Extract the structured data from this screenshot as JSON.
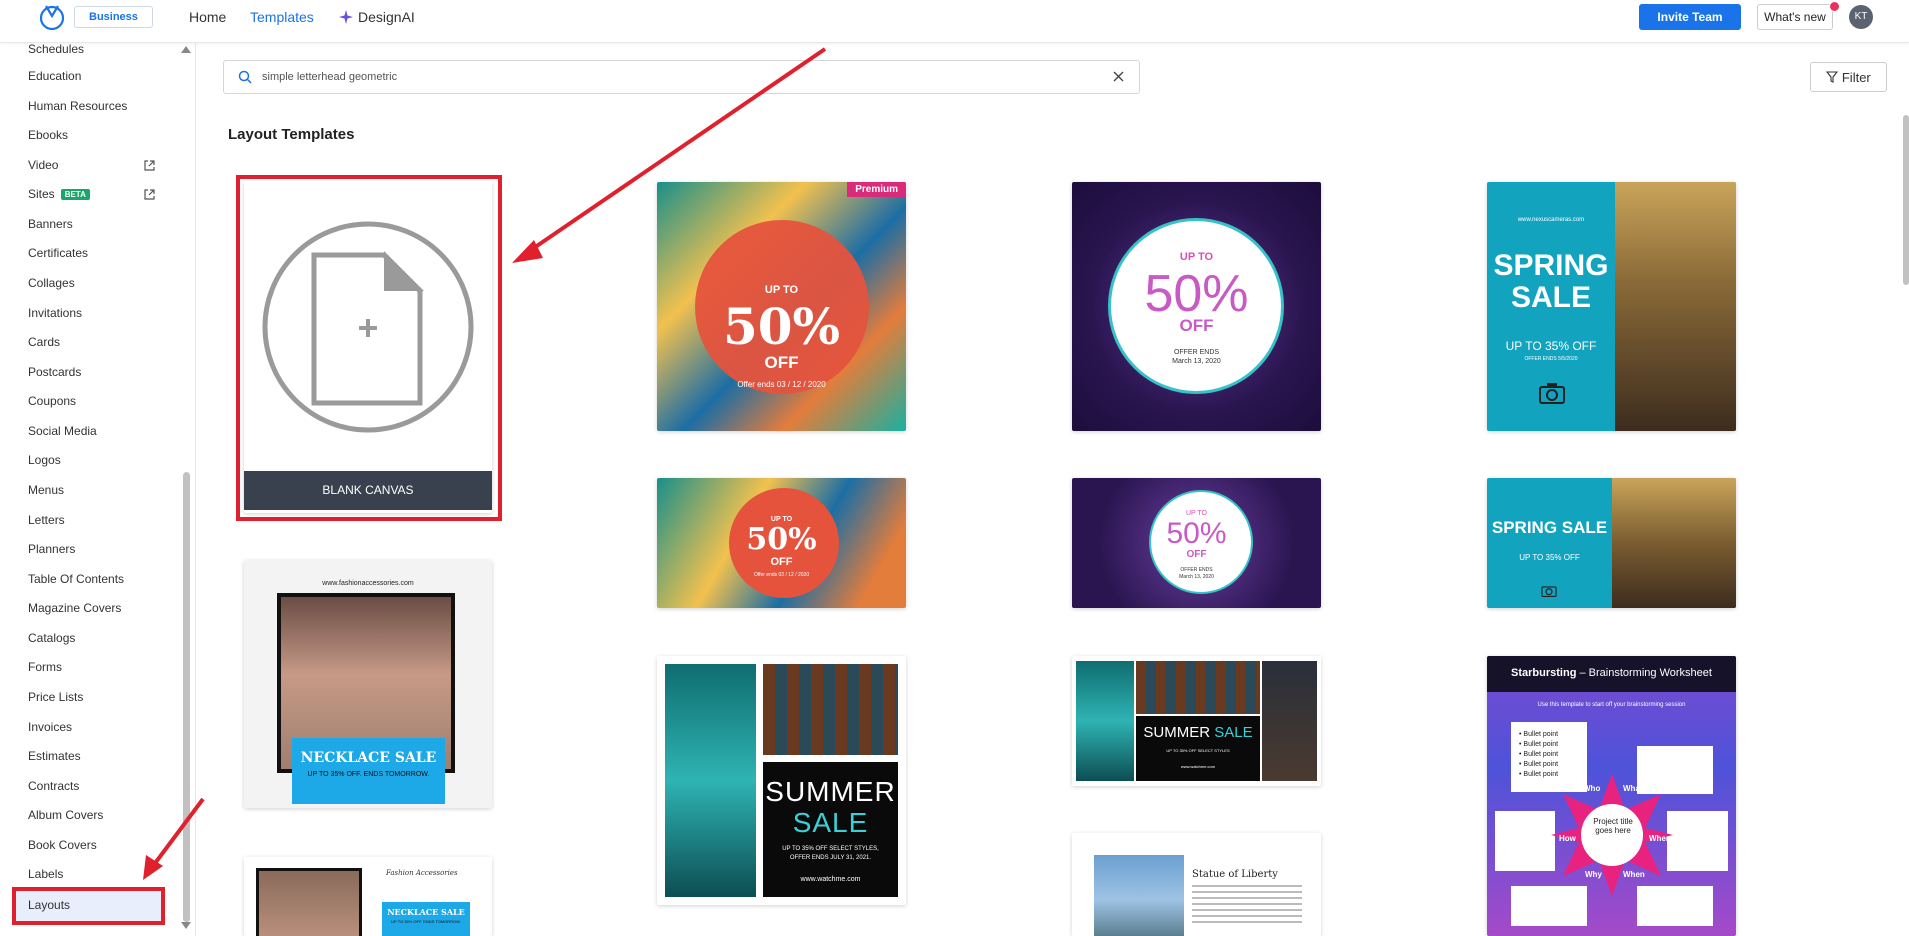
{
  "header": {
    "plan_badge": "Business",
    "nav": [
      "Home",
      "Templates",
      "DesignAI"
    ],
    "invite_button": "Invite Team",
    "whats_new_button": "What's new",
    "avatar_initials": "KT",
    "accent_color": "#1a73e8"
  },
  "sidebar": {
    "items": [
      "Schedules",
      "Education",
      "Human Resources",
      "Ebooks",
      "Video",
      "Sites",
      "Banners",
      "Certificates",
      "Collages",
      "Invitations",
      "Cards",
      "Postcards",
      "Coupons",
      "Social Media",
      "Logos",
      "Menus",
      "Letters",
      "Planners",
      "Table Of Contents",
      "Magazine Covers",
      "Catalogs",
      "Forms",
      "Price Lists",
      "Invoices",
      "Estimates",
      "Contracts",
      "Album Covers",
      "Book Covers",
      "Labels",
      "Layouts"
    ],
    "sites_badge": "BETA",
    "active_item": "Layouts"
  },
  "search": {
    "value": "simple letterhead geometric"
  },
  "filter_button": "Filter",
  "section_title": "Layout Templates",
  "blank_canvas_label": "BLANK CANVAS",
  "premium_badge": "Premium",
  "templates": {
    "sale_tropical": {
      "up_to": "UP TO",
      "percent": "50%",
      "off": "OFF",
      "offer": "Offer ends 03 / 12 / 2020"
    },
    "sale_floral": {
      "up_to": "UP TO",
      "percent": "50%",
      "off": "OFF",
      "offer_ends": "OFFER ENDS",
      "date": "March 13, 2020"
    },
    "spring": {
      "url": "www.nexuscameras.com",
      "title_1": "SPRING",
      "title_2": "SALE",
      "subtitle": "UP TO 35% OFF",
      "fine": "OFFER ENDS 5/5/2020"
    },
    "spring_wide": {
      "title": "SPRING SALE",
      "subtitle": "UP TO 35% OFF"
    },
    "necklace": {
      "url": "www.fashionaccessories.com",
      "title": "NECKLACE SALE",
      "subtitle": "UP TO 35% OFF. ENDS TOMORROW."
    },
    "necklace_2": {
      "brand": "Fashion Accessories",
      "title": "NECKLACE SALE",
      "subtitle": "UP TO 35% OFF. ENDS TOMORROW."
    },
    "summer": {
      "title_1": "SUMMER",
      "title_2": "SALE",
      "fine_1": "UP TO 35% OFF SELECT STYLES,",
      "fine_2": "OFFER ENDS JULY 31, 2021.",
      "url": "www.watchme.com"
    },
    "summer_wide": {
      "title_1": "SUMMER",
      "title_2": "SALE",
      "fine": "UP TO 35% OFF SELECT STYLES",
      "url": "www.watchme.com"
    },
    "starbursting": {
      "title": "Starbursting",
      "title_rest": " – Brainstorming Worksheet",
      "intro": "Use this template to start off your brainstorming session",
      "bullets": [
        "Bullet point",
        "Bullet point",
        "Bullet point",
        "Bullet point",
        "Bullet point"
      ],
      "center": "Project title goes here",
      "points": [
        "Who",
        "What",
        "Where",
        "When",
        "Why",
        "How"
      ]
    },
    "liberty": {
      "title": "Statue of Liberty"
    }
  }
}
